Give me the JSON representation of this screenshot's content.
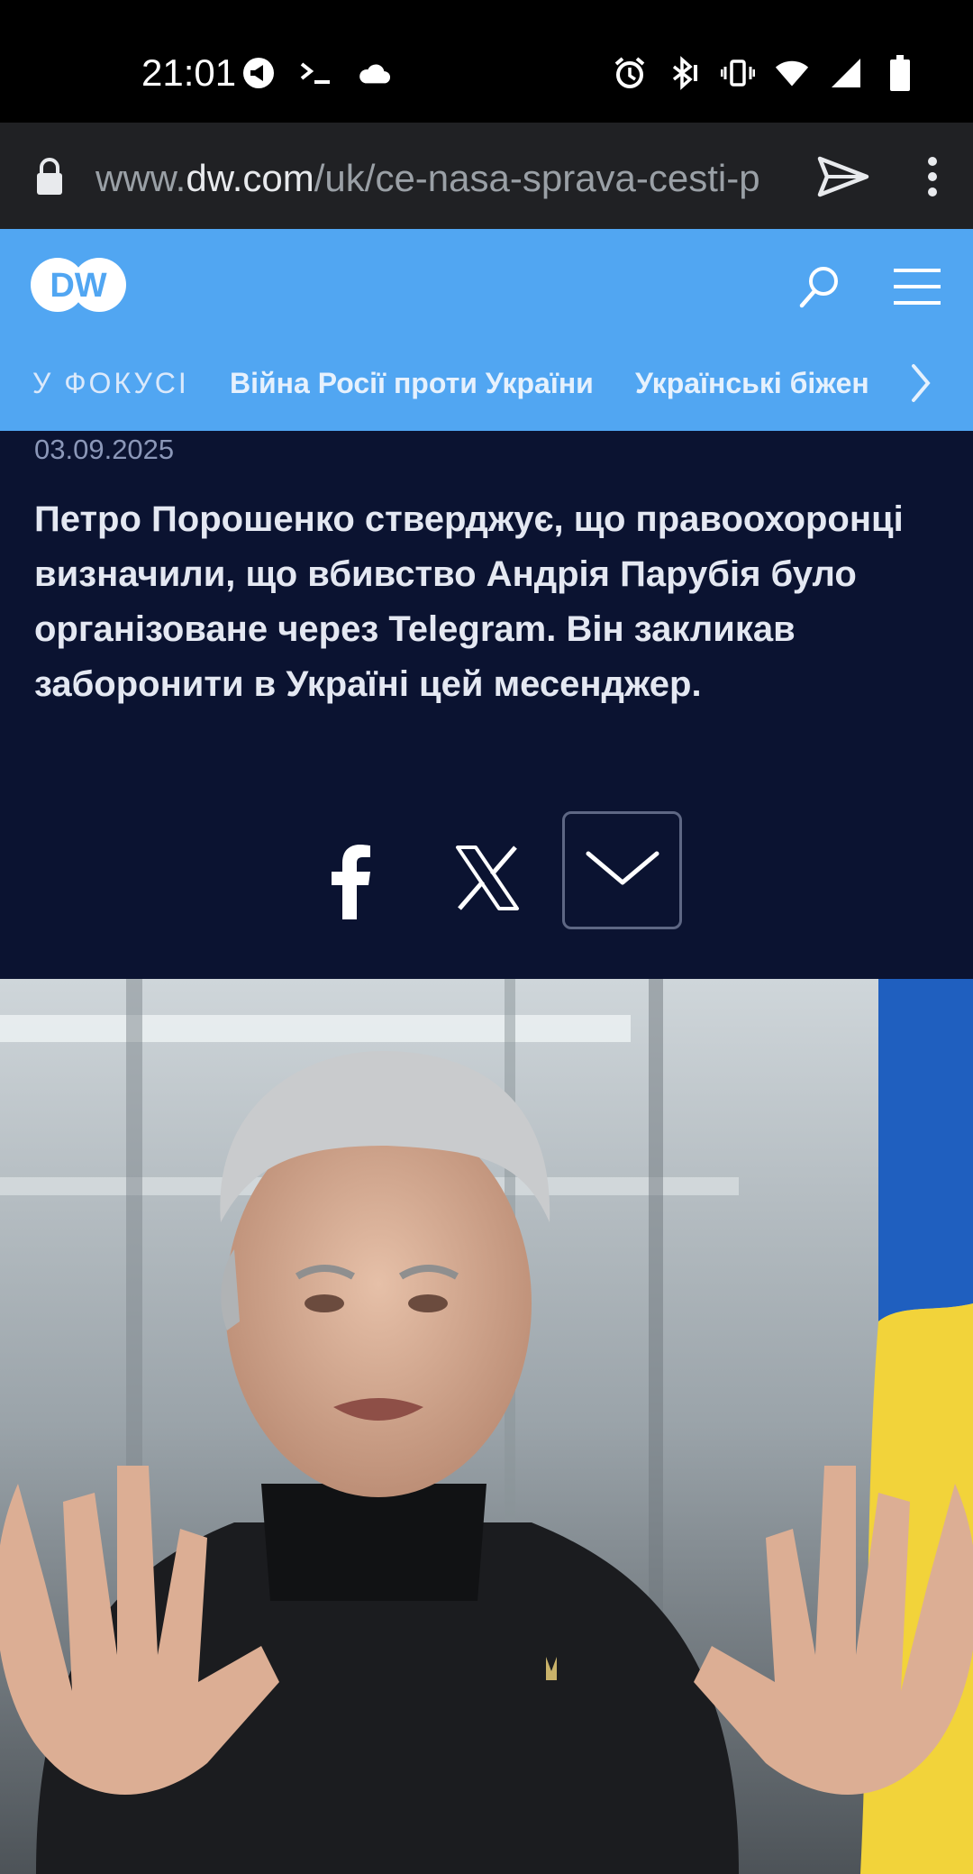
{
  "status_bar": {
    "time": "21:01"
  },
  "browser": {
    "url_prefix": "www.",
    "url_domain": "dw.com",
    "url_path": "/uk/ce-nasa-sprava-cesti-p"
  },
  "site": {
    "logo_text": "DW",
    "nav": {
      "focus_label": "У ФОКУСІ",
      "links": [
        "Війна Росії проти України",
        "Українські біжен"
      ]
    }
  },
  "article": {
    "date": "03.09.2025",
    "teaser": "Петро Порошенко стверджує, що правоохоронці визначили, що вбивство Андрія Парубія було організоване через Telegram. Він закликав заборонити в Україні цей месенджер."
  },
  "colors": {
    "header_blue": "#51a6f2",
    "page_navy": "#0b1331",
    "flag_blue": "#1f5fbf",
    "flag_yellow": "#f2d33a"
  },
  "icons": [
    "lock-icon",
    "send-icon",
    "more-vert-icon",
    "search-icon",
    "menu-icon",
    "chevron-right-icon",
    "facebook-icon",
    "x-icon",
    "chevron-down-icon"
  ]
}
